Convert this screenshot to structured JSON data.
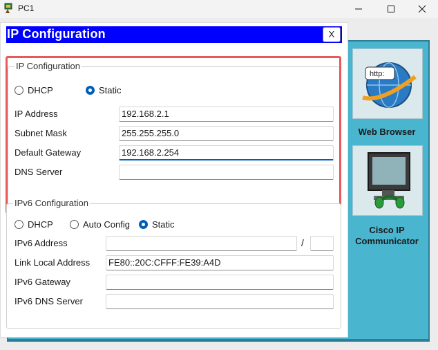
{
  "window": {
    "title": "PC1",
    "icon": "pc-app-icon",
    "controls": [
      "minimize-icon",
      "maximize-icon",
      "close-icon"
    ]
  },
  "dialog": {
    "title": "IP Configuration",
    "close_label": "X"
  },
  "ipv4": {
    "legend": "IP Configuration",
    "mode_options": [
      "DHCP",
      "Static"
    ],
    "selected_mode": "Static",
    "dhcp_label": "DHCP",
    "static_label": "Static",
    "ip_address_label": "IP Address",
    "ip_address": "192.168.2.1",
    "subnet_mask_label": "Subnet Mask",
    "subnet_mask": "255.255.255.0",
    "default_gateway_label": "Default Gateway",
    "default_gateway": "192.168.2.254",
    "dns_server_label": "DNS Server",
    "dns_server": ""
  },
  "ipv6": {
    "legend": "IPv6 Configuration",
    "mode_options": [
      "DHCP",
      "Auto Config",
      "Static"
    ],
    "selected_mode": "Static",
    "dhcp_label": "DHCP",
    "auto_config_label": "Auto Config",
    "static_label": "Static",
    "address_label": "IPv6 Address",
    "address": "",
    "prefix_separator": "/",
    "prefix_length": "",
    "link_local_label": "Link Local Address",
    "link_local": "FE80::20C:CFFF:FE39:A4D",
    "gateway_label": "IPv6 Gateway",
    "gateway": "",
    "dns_label": "IPv6 DNS Server",
    "dns": ""
  },
  "desktop_apps": [
    {
      "label": "Web Browser",
      "icon": "web-browser-icon",
      "icon_text": "http:"
    },
    {
      "label": "Cisco IP Communicator",
      "icon": "cisco-ip-communicator-icon"
    }
  ],
  "colors": {
    "dialog_header": "#0000ff",
    "highlight_border": "#e85a5a",
    "desktop_panel": "#4ab5cf",
    "radio_selected": "#005fb8"
  }
}
